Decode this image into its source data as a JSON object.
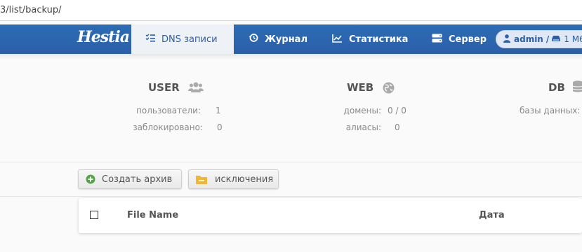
{
  "browser": {
    "url": "3/list/backup/"
  },
  "nav": {
    "logo": "Hestia",
    "items": [
      {
        "label": "DNS записи",
        "icon": "list-check-icon",
        "active": true
      },
      {
        "label": "Журнал",
        "icon": "history-icon"
      },
      {
        "label": "Статистика",
        "icon": "chart-line-icon"
      },
      {
        "label": "Сервер",
        "icon": "server-icon"
      }
    ],
    "user": {
      "name": "admin",
      "separator": "/",
      "disk": "1 M6"
    }
  },
  "stats": {
    "user": {
      "title": "USER",
      "icon": "users-icon",
      "rows": [
        {
          "label": "пользователи:",
          "value": "1"
        },
        {
          "label": "заблокировано:",
          "value": "0"
        }
      ]
    },
    "web": {
      "title": "WEB",
      "icon": "globe-icon",
      "rows": [
        {
          "label": "домены:",
          "value": "0 / 0"
        },
        {
          "label": "алиасы:",
          "value": "0"
        }
      ]
    },
    "db": {
      "title": "DB",
      "icon": "database-icon",
      "rows": [
        {
          "label": "базы данных:",
          "value": ""
        }
      ]
    }
  },
  "toolbar": {
    "create_label": "Создать архив",
    "exclusions_label": "исключения"
  },
  "table": {
    "columns": [
      "File Name",
      "Дата"
    ]
  },
  "colors": {
    "accent": "#2b5fa8",
    "add": "#52a447",
    "folder": "#f2b632"
  }
}
